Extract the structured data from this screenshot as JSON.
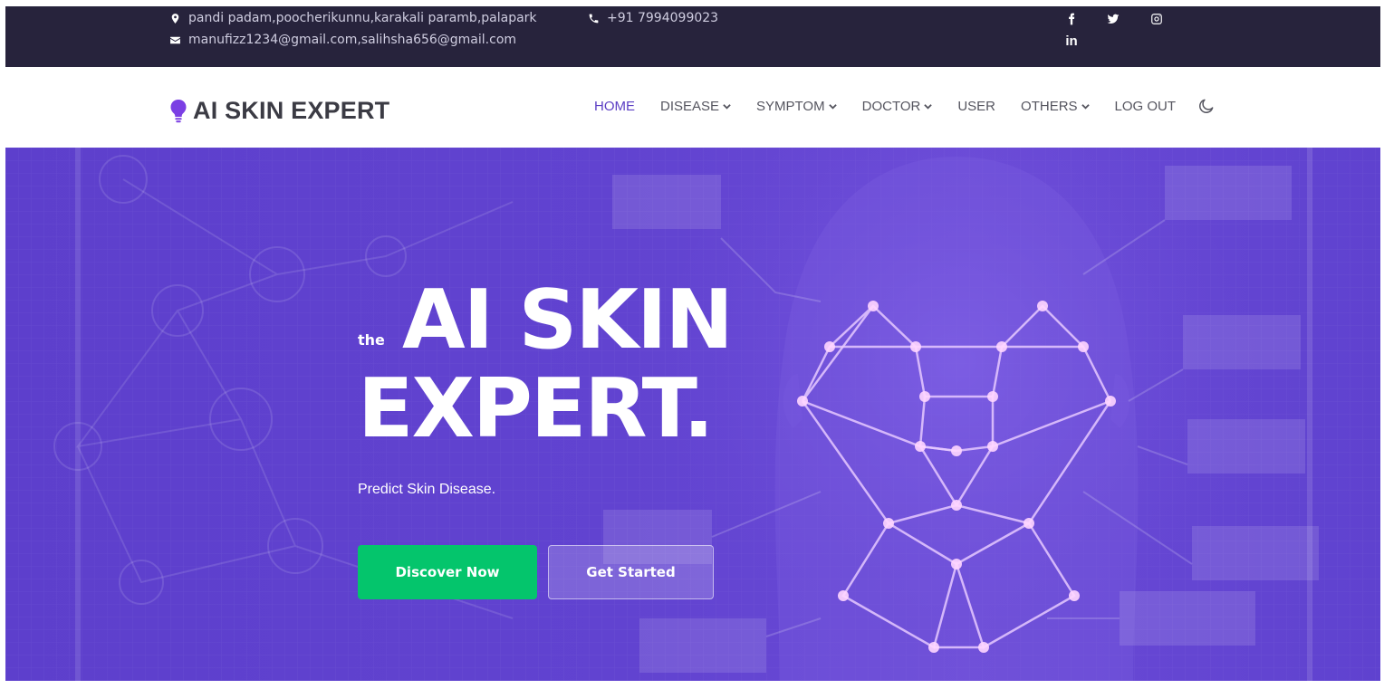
{
  "topbar": {
    "address": "pandi padam,poocherikunnu,karakali paramb,palapark",
    "phone": "+91 7994099023",
    "email": "manufizz1234@gmail.com,salihsha656@gmail.com",
    "social": [
      "facebook-icon",
      "twitter-icon",
      "instagram-icon",
      "linkedin-icon"
    ],
    "linkedin_label": "in"
  },
  "brand": {
    "name": "AI SKIN EXPERT",
    "icon": "lightbulb-icon",
    "color": "#7b3fe4"
  },
  "nav": {
    "items": [
      {
        "label": "HOME",
        "active": true,
        "dropdown": false
      },
      {
        "label": "DISEASE",
        "active": false,
        "dropdown": true
      },
      {
        "label": "SYMPTOM",
        "active": false,
        "dropdown": true
      },
      {
        "label": "DOCTOR",
        "active": false,
        "dropdown": true
      },
      {
        "label": "USER",
        "active": false,
        "dropdown": false
      },
      {
        "label": "OTHERS",
        "active": false,
        "dropdown": true
      },
      {
        "label": "LOG OUT",
        "active": false,
        "dropdown": false
      }
    ],
    "theme_toggle": "moon-icon",
    "active_color": "#5c3fc4"
  },
  "hero": {
    "prefix": "the",
    "title_line1": "AI SKIN",
    "title_line2": "EXPERT.",
    "subtitle": "Predict Skin Disease.",
    "primary_button": "Discover Now",
    "secondary_button": "Get Started",
    "background_color": "#6143d0",
    "primary_button_color": "#04c56c"
  }
}
